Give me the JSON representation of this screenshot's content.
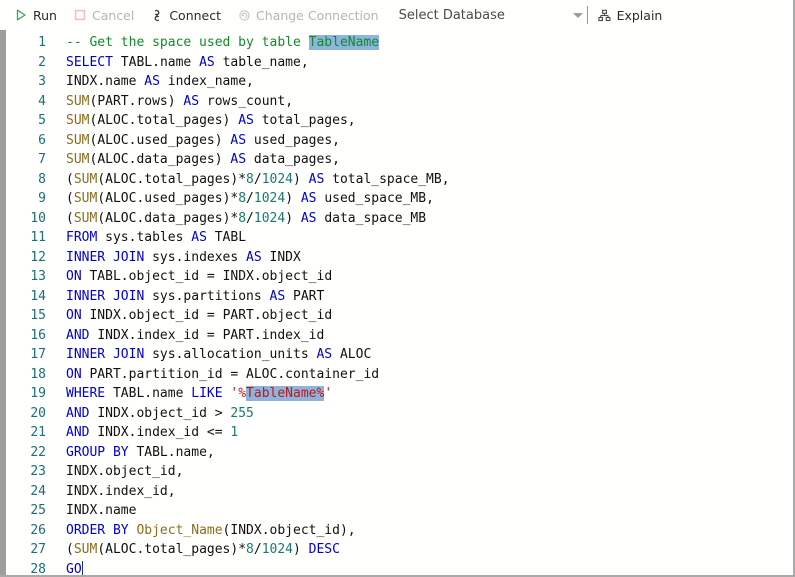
{
  "toolbar": {
    "run": {
      "label": "Run",
      "icon": "play-icon",
      "enabled": true
    },
    "cancel": {
      "label": "Cancel",
      "icon": "stop-square-icon",
      "enabled": false
    },
    "connect": {
      "label": "Connect",
      "icon": "plug-icon",
      "enabled": true
    },
    "change_connection": {
      "label": "Change Connection",
      "icon": "refresh-circle-icon",
      "enabled": false
    },
    "database_select": {
      "value": "Select Database",
      "placeholder": "Select Database",
      "caret_icon": "chevron-down-icon"
    },
    "explain": {
      "label": "Explain",
      "icon": "hierarchy-icon",
      "enabled": true
    }
  },
  "editor": {
    "language": "sql",
    "cursor_line": 28,
    "selection_text": "TableName",
    "line_numbers": [
      1,
      2,
      3,
      4,
      5,
      6,
      7,
      8,
      9,
      10,
      11,
      12,
      13,
      14,
      15,
      16,
      17,
      18,
      19,
      20,
      21,
      22,
      23,
      24,
      25,
      26,
      27,
      28
    ],
    "lines": [
      "-- Get the space used by table TableName",
      "SELECT TABL.name AS table_name,",
      "INDX.name AS index_name,",
      "SUM(PART.rows) AS rows_count,",
      "SUM(ALOC.total_pages) AS total_pages,",
      "SUM(ALOC.used_pages) AS used_pages,",
      "SUM(ALOC.data_pages) AS data_pages,",
      "(SUM(ALOC.total_pages)*8/1024) AS total_space_MB,",
      "(SUM(ALOC.used_pages)*8/1024) AS used_space_MB,",
      "(SUM(ALOC.data_pages)*8/1024) AS data_space_MB",
      "FROM sys.tables AS TABL",
      "INNER JOIN sys.indexes AS INDX",
      "ON TABL.object_id = INDX.object_id",
      "INNER JOIN sys.partitions AS PART",
      "ON INDX.object_id = PART.object_id",
      "AND INDX.index_id = PART.index_id",
      "INNER JOIN sys.allocation_units AS ALOC",
      "ON PART.partition_id = ALOC.container_id",
      "WHERE TABL.name LIKE '%TableName%'",
      "AND INDX.object_id > 255",
      "AND INDX.index_id <= 1",
      "GROUP BY TABL.name,",
      "INDX.object_id,",
      "INDX.index_id,",
      "INDX.name",
      "ORDER BY Object_Name(INDX.object_id),",
      "(SUM(ALOC.total_pages)*8/1024) DESC",
      "GO"
    ]
  },
  "colors": {
    "keyword": "#0000d4",
    "function": "#8a6d1f",
    "number": "#1a7a6e",
    "string": "#c81414",
    "comment": "#128a2a",
    "selection": "#8cb4dc",
    "line_number": "#1a6e7e",
    "background": "#fffffd"
  }
}
